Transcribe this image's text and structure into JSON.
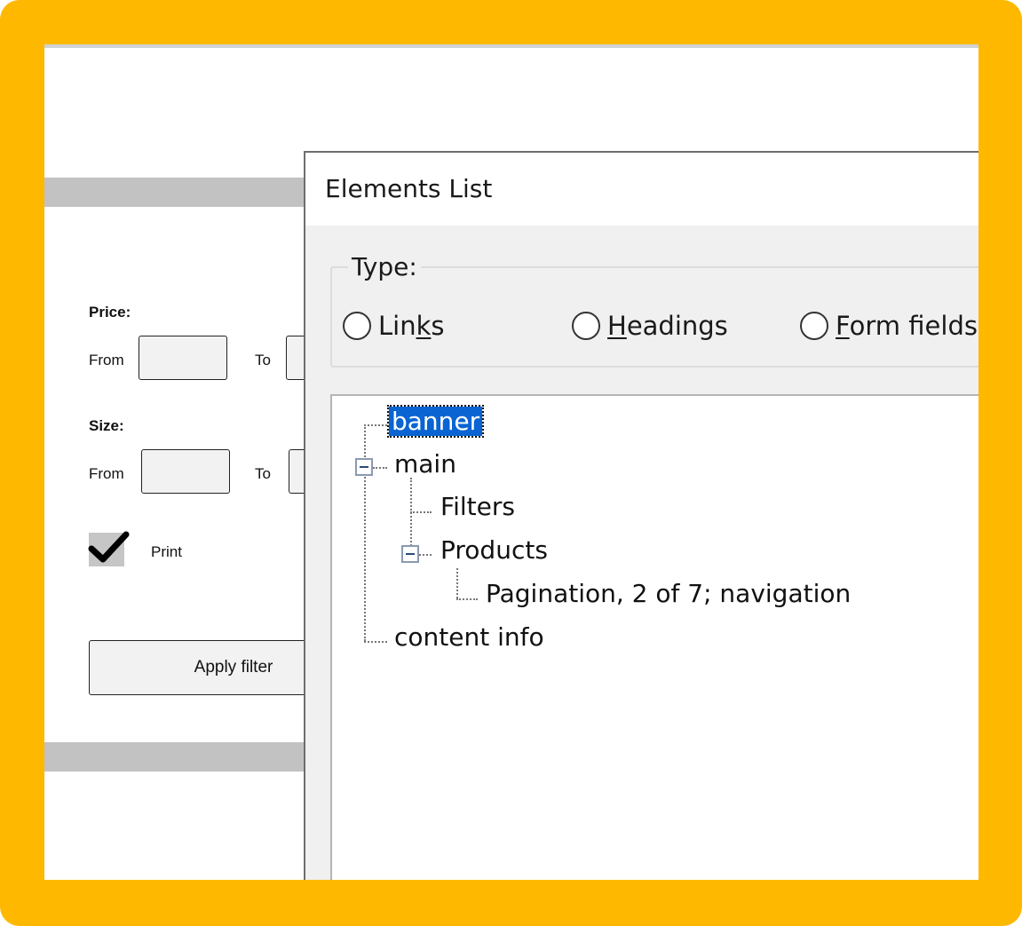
{
  "colors": {
    "frame": "#FFB800",
    "selection": "#0a64d2"
  },
  "filters": {
    "price_label": "Price:",
    "size_label": "Size:",
    "from_label": "From",
    "to_label": "To",
    "print_label": "Print",
    "print_checked": true,
    "apply_label": "Apply filter"
  },
  "dialog": {
    "title": "Elements List",
    "type_legend": "Type:",
    "radios": [
      {
        "pre": "Lin",
        "key": "k",
        "post": "s"
      },
      {
        "pre": "",
        "key": "H",
        "post": "eadings"
      },
      {
        "pre": "",
        "key": "F",
        "post": "orm fields"
      }
    ],
    "tree": {
      "banner": "banner",
      "main": "main",
      "filters": "Filters",
      "products": "Products",
      "pagination": "Pagination, 2 of 7; navigation",
      "contentinfo": "content info"
    }
  }
}
